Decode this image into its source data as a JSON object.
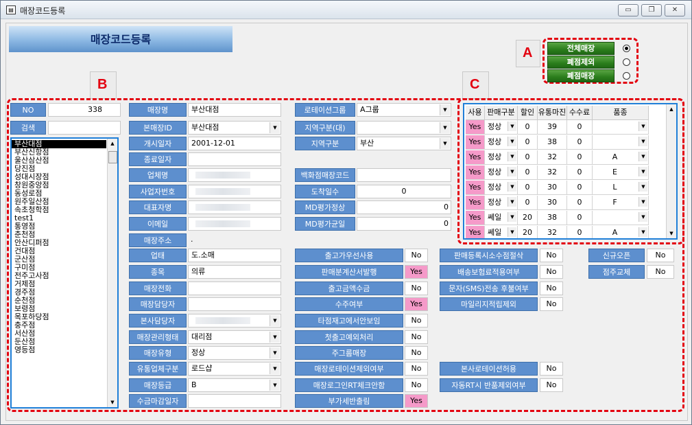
{
  "window": {
    "title": "매장코드등록",
    "icon": "form-icon",
    "controls": [
      "minimize-icon",
      "restore-icon",
      "close-icon"
    ]
  },
  "banner": {
    "title": "매장코드등록"
  },
  "markers": {
    "a": "A",
    "b": "B",
    "c": "C"
  },
  "filter": [
    {
      "label": "전체매장",
      "selected": true
    },
    {
      "label": "폐점제외",
      "selected": false
    },
    {
      "label": "폐점매장",
      "selected": false
    }
  ],
  "left": {
    "no_label": "NO",
    "no_value": "338",
    "search_label": "검색",
    "search_value": "",
    "stores": [
      "부산대점",
      "부산신항점",
      "울산삼산점",
      "당진점",
      "성대시장점",
      "창원중앙점",
      "동성로점",
      "원주일산점",
      "속초청학점",
      "test1",
      "통영점",
      "춘천점",
      "안산디퍼점",
      "건대점",
      "군산점",
      "구미점",
      "전주고사점",
      "거제점",
      "경주점",
      "순천점",
      "보령점",
      "목포하당점",
      "충주점",
      "서산점",
      "둔산점",
      "영등점"
    ],
    "selected_index": 0
  },
  "form": {
    "c1": [
      {
        "label": "매장명",
        "value": "부산대점",
        "dd": false
      },
      {
        "label": "본매장ID",
        "value": "부산대점",
        "dd": true
      },
      {
        "label": "개시일자",
        "value": "2001-12-01",
        "dd": false
      },
      {
        "label": "종료일자",
        "value": "",
        "dd": false
      },
      {
        "label": "업체명",
        "value": "",
        "blur": true,
        "dd": false
      },
      {
        "label": "사업자번호",
        "value": "",
        "blur": true,
        "dd": false
      },
      {
        "label": "대표자명",
        "value": "",
        "blur": true,
        "dd": false
      },
      {
        "label": "이메일",
        "value": "",
        "blur": true,
        "dd": false
      }
    ],
    "address_label": "매장주소",
    "address_value": ".",
    "c1b": [
      {
        "label": "업태",
        "value": "도.소매",
        "dd": false
      },
      {
        "label": "종목",
        "value": "의류",
        "dd": false
      },
      {
        "label": "매장전화",
        "value": "",
        "dd": false
      },
      {
        "label": "매장담당자",
        "value": "",
        "dd": false
      },
      {
        "label": "본사담당자",
        "value": "",
        "blur": true,
        "dd": true
      },
      {
        "label": "매장관리형태",
        "value": "대리점",
        "dd": true
      },
      {
        "label": "매장유형",
        "value": "정상",
        "dd": true
      },
      {
        "label": "유통업체구분",
        "value": "로드샵",
        "dd": true
      },
      {
        "label": "매장등급",
        "value": "B",
        "dd": true
      },
      {
        "label": "수금마감일자",
        "value": "",
        "dd": false
      }
    ],
    "c2": [
      {
        "label": "로테이션그룹",
        "value": "A그룹",
        "dd": true
      },
      {
        "label": "지역구분(대)",
        "value": "",
        "dd": true
      },
      {
        "label": "지역구분",
        "value": "부산",
        "dd": true
      },
      {
        "label": "",
        "value": "",
        "dd": false,
        "hidden": true
      },
      {
        "label": "백화점매장코드",
        "value": "",
        "dd": false
      },
      {
        "label": "도착일수",
        "value": "0",
        "align": "c",
        "dd": false
      },
      {
        "label": "MD평가정상",
        "value": "0",
        "align": "r",
        "dd": false
      },
      {
        "label": "MD평가균일",
        "value": "0",
        "align": "r",
        "dd": false
      }
    ],
    "flags": [
      {
        "label": "출고가우선사용",
        "value": "No"
      },
      {
        "label": "판매분계산서발행",
        "value": "Yes"
      },
      {
        "label": "출고금액수금",
        "value": "No"
      },
      {
        "label": "수주여부",
        "value": "Yes"
      },
      {
        "label": "타점재고에서안보임",
        "value": "No"
      },
      {
        "label": "첫출고예외처리",
        "value": "No"
      },
      {
        "label": "주그룹매장",
        "value": "No"
      },
      {
        "label": "매장로테이션제외여부",
        "value": "No"
      },
      {
        "label": "매장로그인RT체크안함",
        "value": "No"
      },
      {
        "label": "부가세반출림",
        "value": "Yes"
      }
    ],
    "flags2": [
      {
        "label": "판매등록시소수점절삭",
        "value": "No",
        "row": 0
      },
      {
        "label": "배송보험료적용여부",
        "value": "No",
        "row": 1
      },
      {
        "label": "문자(SMS)전송 후불여부",
        "value": "No",
        "row": 2
      },
      {
        "label": "마일리지적립제외",
        "value": "No",
        "row": 3
      },
      {
        "label": "본사로테이션허용",
        "value": "No",
        "row": 7
      },
      {
        "label": "자동RT시 반품제외여부",
        "value": "No",
        "row": 8
      }
    ],
    "flags3": [
      {
        "label": "신규오픈",
        "value": "No"
      },
      {
        "label": "점주교체",
        "value": "No"
      }
    ]
  },
  "grid": {
    "headers": [
      "사용",
      "판매구분",
      "할인율",
      "유통마진",
      "수수료",
      "품종"
    ],
    "rows": [
      [
        "Yes",
        "정상",
        "0",
        "39",
        "0",
        ""
      ],
      [
        "Yes",
        "정상",
        "0",
        "38",
        "0",
        ""
      ],
      [
        "Yes",
        "정상",
        "0",
        "32",
        "0",
        "A"
      ],
      [
        "Yes",
        "정상",
        "0",
        "32",
        "0",
        "E"
      ],
      [
        "Yes",
        "정상",
        "0",
        "30",
        "0",
        "L"
      ],
      [
        "Yes",
        "정상",
        "0",
        "30",
        "0",
        "F"
      ],
      [
        "Yes",
        "쎄일",
        "20",
        "38",
        "0",
        ""
      ],
      [
        "Yes",
        "쎄일",
        "20",
        "32",
        "0",
        "A"
      ]
    ]
  }
}
